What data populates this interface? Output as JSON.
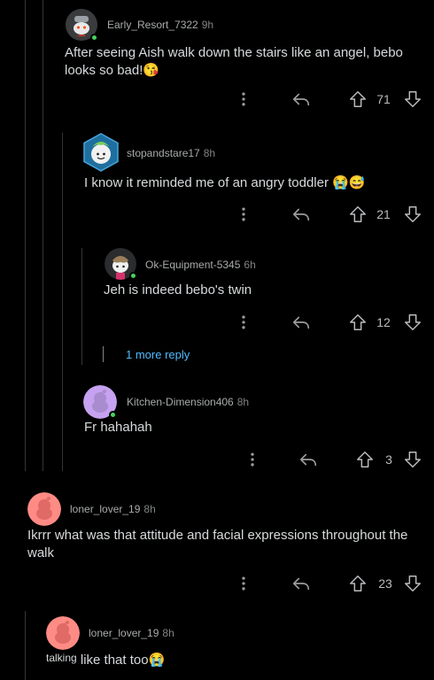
{
  "comments": [
    {
      "username": "Early_Resort_7322",
      "time": "9h",
      "text": "After seeing Aish walk down the stairs like an angel, bebo looks so bad!😘",
      "votes": "71"
    },
    {
      "username": "stopandstare17",
      "time": "8h",
      "text": "I know it reminded me of an angry toddler 😭😅",
      "votes": "21"
    },
    {
      "username": "Ok-Equipment-5345",
      "time": "6h",
      "text": "Jeh is indeed bebo's twin",
      "votes": "12"
    },
    {
      "username": "Kitchen-Dimension406",
      "time": "8h",
      "text": "Fr hahahah",
      "votes": "3"
    },
    {
      "username": "loner_lover_19",
      "time": "8h",
      "text": "Ikrrr what was that attitude and facial expressions throughout the walk",
      "votes": "23"
    },
    {
      "username": "loner_lover_19",
      "time": "8h",
      "text_prefix": "talking",
      "text": "like that too😭"
    }
  ],
  "more_replies_label": "1 more reply",
  "colors": {
    "background": "#000000",
    "thread_line": "#343536",
    "link": "#4fbcff",
    "online": "#46d160",
    "avatar_pink": "#ff8b85",
    "avatar_purple": "#c6a2f0"
  },
  "icons": {
    "more": "more-vertical-icon",
    "reply": "reply-arrow-icon",
    "upvote": "upvote-arrow-icon",
    "downvote": "downvote-arrow-icon"
  }
}
